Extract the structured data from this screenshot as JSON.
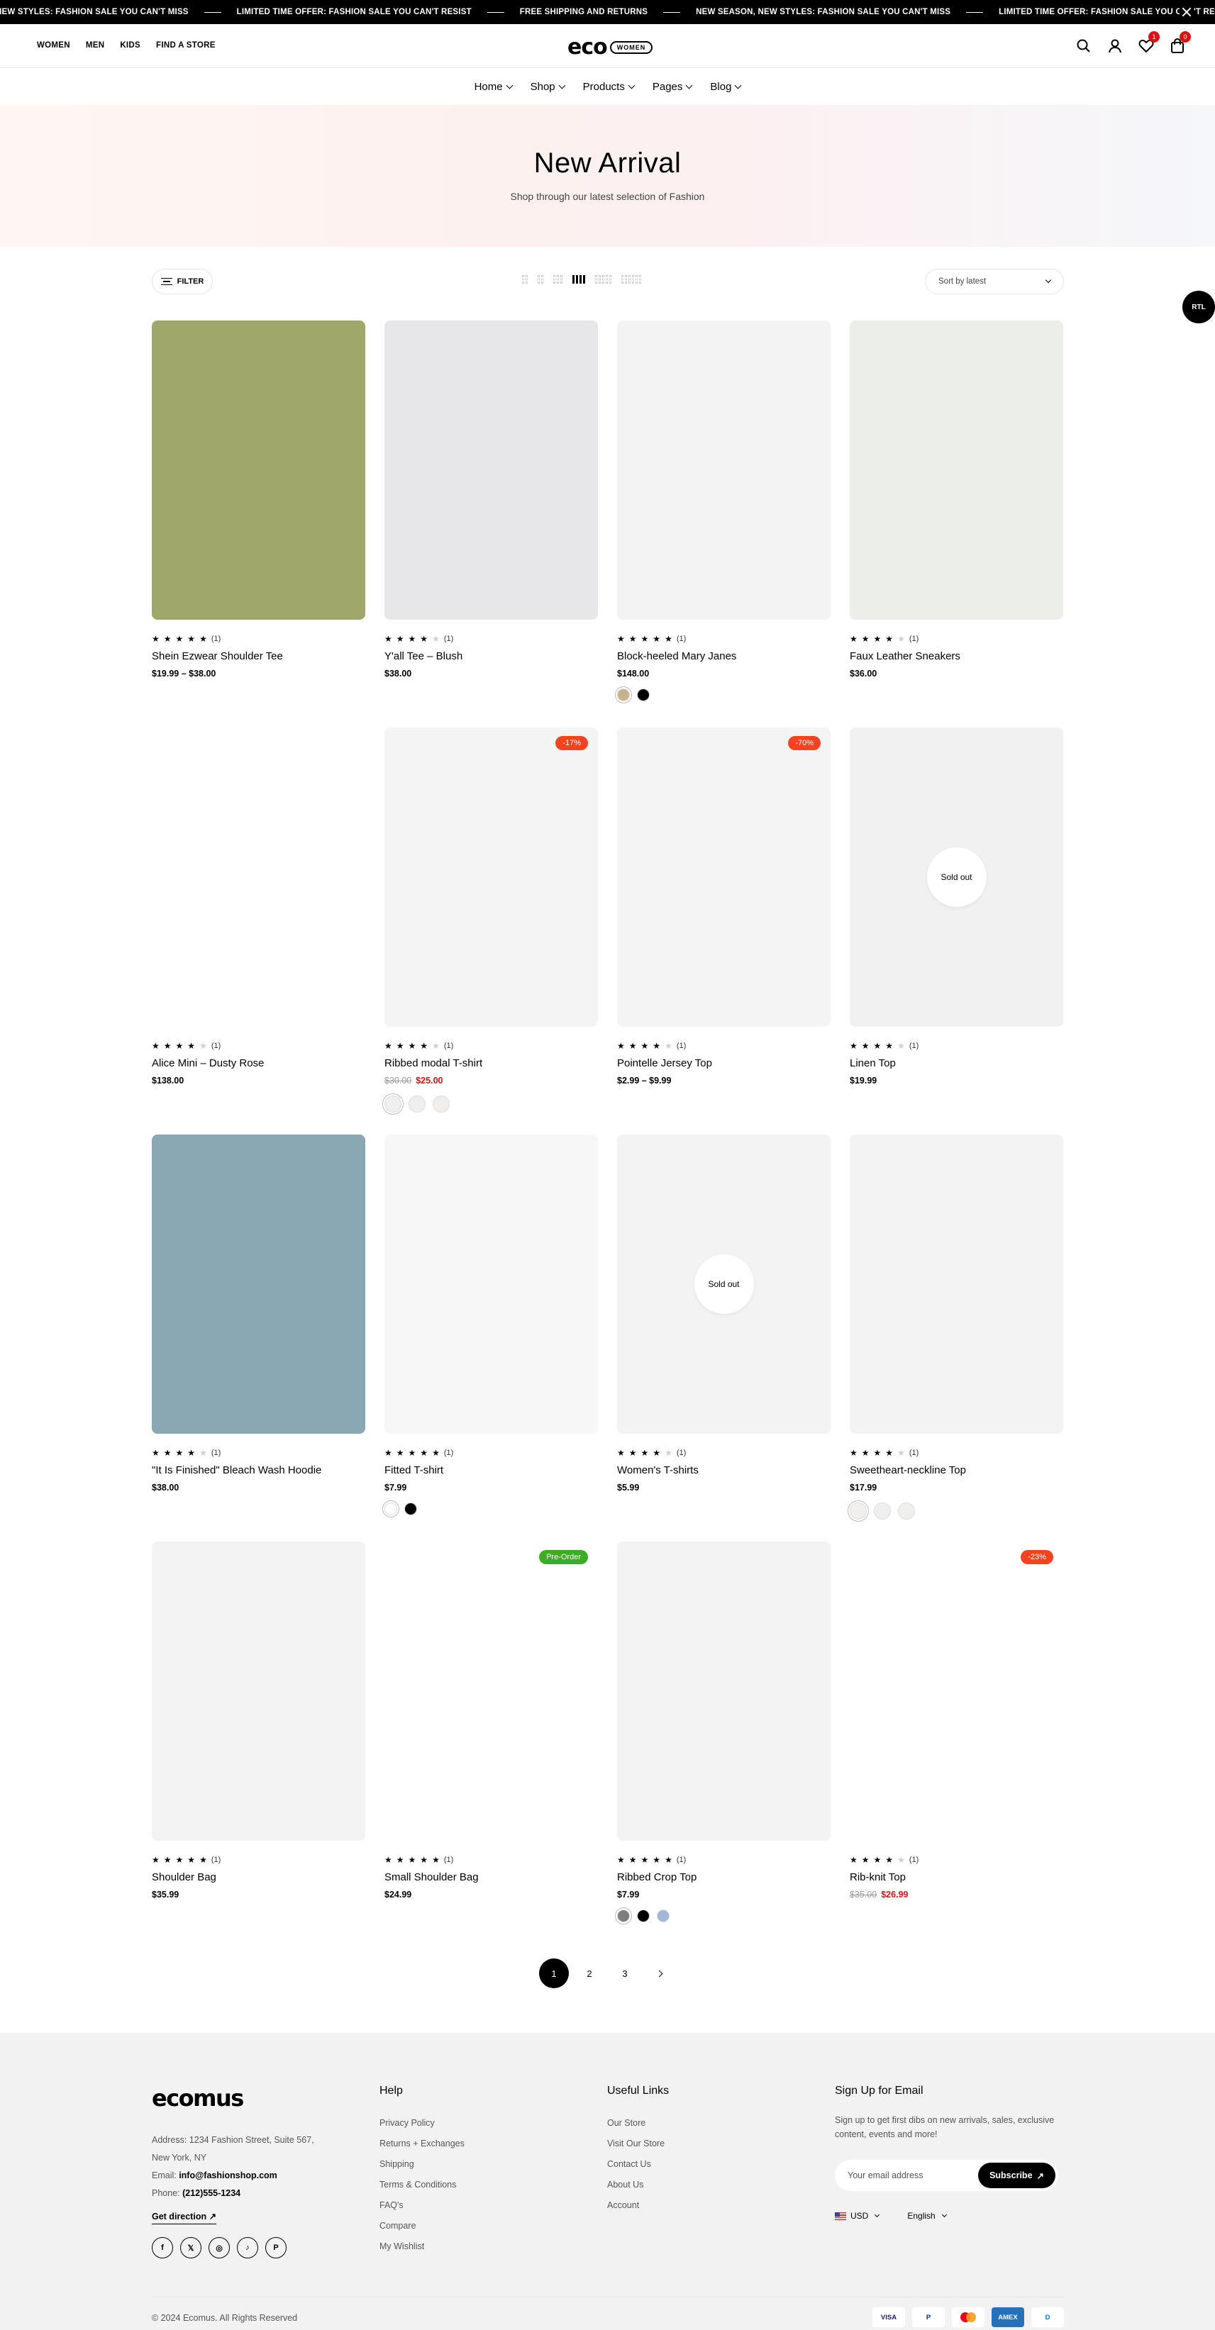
{
  "announcement": {
    "messages": [
      "NEW STYLES: FASHION SALE YOU CAN'T MISS",
      "LIMITED TIME OFFER: FASHION SALE YOU CAN'T RESIST",
      "FREE SHIPPING AND RETURNS",
      "NEW SEASON, NEW STYLES: FASHION SALE YOU CAN'T MISS",
      "LIMITED TIME OFFER: FASHION SALE YOU CAN'T RE"
    ]
  },
  "header": {
    "links": [
      "WOMEN",
      "MEN",
      "KIDS",
      "FIND A STORE"
    ],
    "logo_word": "eco",
    "logo_pill": "WOMEN",
    "wishlist_count": "1",
    "cart_count": "0"
  },
  "nav": {
    "items": [
      "Home",
      "Shop",
      "Products",
      "Pages",
      "Blog"
    ]
  },
  "hero": {
    "title": "New Arrival",
    "subtitle": "Shop through our latest selection of Fashion"
  },
  "toolbar": {
    "filter_label": "FILTER",
    "sort_label": "Sort by latest",
    "rtl_label": "RTL"
  },
  "products": [
    {
      "name": "Shein Ezwear Shoulder Tee",
      "rating": 5,
      "reviews": "(1)",
      "price": "$19.99  –  $38.00",
      "bg": "#9fa86a"
    },
    {
      "name": "Y'all Tee – Blush",
      "rating": 4,
      "reviews": "(1)",
      "price": "$38.00",
      "bg": "#e7e7e9"
    },
    {
      "name": "Block-heeled Mary Janes",
      "rating": 5,
      "reviews": "(1)",
      "price": "$148.00",
      "bg": "#f3f3f3",
      "swatches": [
        "#c8b28c",
        "#000000"
      ]
    },
    {
      "name": "Faux Leather Sneakers",
      "rating": 4,
      "reviews": "(1)",
      "price": "$36.00",
      "bg": "#eceeea"
    },
    {
      "name": "Alice Mini – Dusty Rose",
      "rating": 4,
      "reviews": "(1)",
      "price": "$138.00",
      "bg": "#ffffff"
    },
    {
      "name": "Ribbed modal T-shirt",
      "rating": 4,
      "reviews": "(1)",
      "old_price": "$30.00",
      "sale_price": "$25.00",
      "tag": "-17%",
      "bg": "#f4f4f4",
      "image_swatches": 3
    },
    {
      "name": "Pointelle Jersey Top",
      "rating": 4,
      "reviews": "(1)",
      "price": "$2.99  –  $9.99",
      "tag": "-70%",
      "bg": "#f4f4f4"
    },
    {
      "name": "Linen Top",
      "rating": 4,
      "reviews": "(1)",
      "price": "$19.99",
      "soldout": "Sold out",
      "bg": "#f1f1f1"
    },
    {
      "name": "\"It Is Finished\" Bleach Wash Hoodie",
      "rating": 4,
      "reviews": "(1)",
      "price": "$38.00",
      "bg": "#8aa7b4"
    },
    {
      "name": "Fitted T-shirt",
      "rating": 5,
      "reviews": "(1)",
      "price": "$7.99",
      "bg": "#f7f7f7",
      "swatches": [
        "#ffffff",
        "#000000"
      ]
    },
    {
      "name": "Women's T-shirts",
      "rating": 4,
      "reviews": "(1)",
      "price": "$5.99",
      "soldout": "Sold out",
      "bg": "#f3f3f3"
    },
    {
      "name": "Sweetheart-neckline Top",
      "rating": 4,
      "reviews": "(1)",
      "price": "$17.99",
      "bg": "#f3f3f3",
      "image_swatches": 3
    },
    {
      "name": "Shoulder Bag",
      "rating": 5,
      "reviews": "(1)",
      "price": "$35.99",
      "bg": "#f3f3f3"
    },
    {
      "name": "Small Shoulder Bag",
      "rating": 5,
      "reviews": "(1)",
      "price": "$24.99",
      "tag": "Pre-Order",
      "tag_green": true,
      "bg": "#ffffff"
    },
    {
      "name": "Ribbed Crop Top",
      "rating": 5,
      "reviews": "(1)",
      "price": "$7.99",
      "bg": "#f3f3f3",
      "swatches": [
        "#7d7d7d",
        "#000000",
        "#a3b8d6"
      ]
    },
    {
      "name": "Rib-knit Top",
      "rating": 4,
      "reviews": "(1)",
      "old_price": "$35.00",
      "sale_price": "$26.99",
      "tag": "-23%",
      "bg": "#ffffff"
    }
  ],
  "pagination": {
    "pages": [
      "1",
      "2",
      "3"
    ],
    "active": "1"
  },
  "footer": {
    "logo": "ecomus",
    "address_line1": "Address: 1234 Fashion Street, Suite 567,",
    "address_line2": "New York, NY",
    "email_label": "Email: ",
    "email": "info@fashionshop.com",
    "phone_label": "Phone: ",
    "phone": "(212)555-1234",
    "direction": "Get direction",
    "help_title": "Help",
    "help_links": [
      "Privacy Policy",
      "Returns + Exchanges",
      "Shipping",
      "Terms & Conditions",
      "FAQ's",
      "Compare",
      "My Wishlist"
    ],
    "useful_title": "Useful Links",
    "useful_links": [
      "Our Store",
      "Visit Our Store",
      "Contact Us",
      "About Us",
      "Account"
    ],
    "signup_title": "Sign Up for Email",
    "signup_text": "Sign up to get first dibs on new arrivals, sales, exclusive content, events and more!",
    "email_placeholder": "Your email address",
    "subscribe_label": "Subscribe",
    "currency": "USD",
    "language": "English",
    "copyright": "© 2024 Ecomus. All Rights Reserved",
    "payments": [
      "VISA",
      "P",
      "MC",
      "AMEX",
      "D"
    ]
  }
}
